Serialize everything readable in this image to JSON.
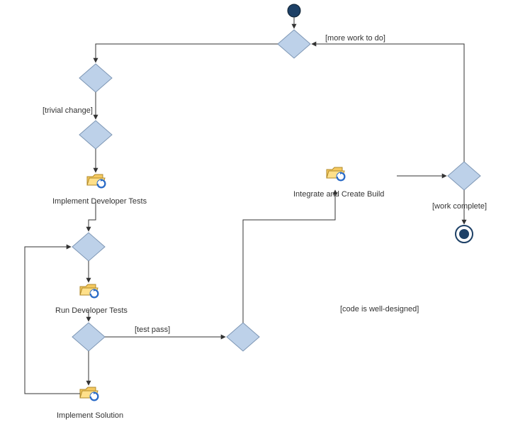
{
  "guards": {
    "trivial_change": "[trivial change]",
    "test_pass": "[test pass]",
    "code_well_designed": "[code is well-designed]",
    "more_work": "[more work to do]",
    "work_complete": "[work complete]"
  },
  "tasks": {
    "implement_dev_tests": "Implement Developer Tests",
    "run_dev_tests": "Run Developer Tests",
    "implement_solution": "Implement Solution",
    "integrate_build": "Integrate and Create Build"
  }
}
